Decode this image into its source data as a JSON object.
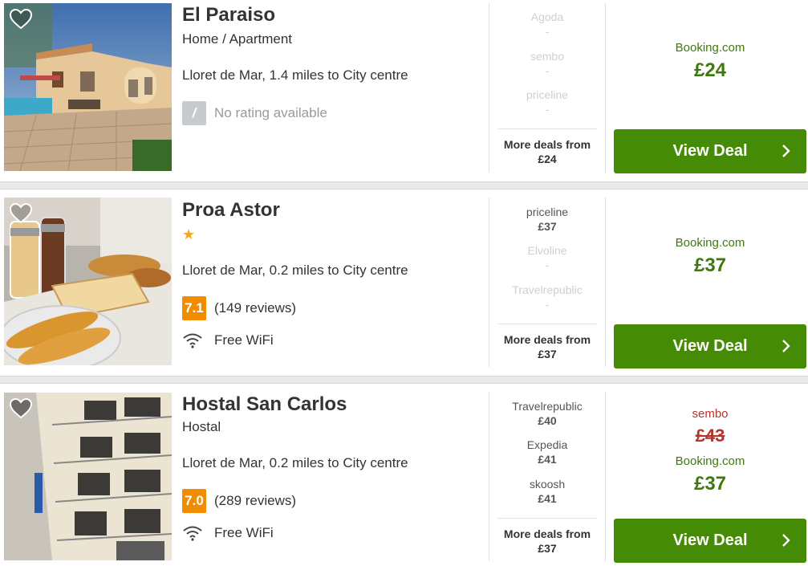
{
  "hotels": [
    {
      "name": "El Paraiso",
      "type": "Home / Apartment",
      "location": "Lloret de Mar, 1.4 miles to City centre",
      "score": "/",
      "rating_text": "No rating available",
      "deals": [
        {
          "provider": "Agoda",
          "price": "-"
        },
        {
          "provider": "sembo",
          "price": "-"
        },
        {
          "provider": "priceline",
          "price": "-"
        }
      ],
      "more_deals_label": "More deals from",
      "more_deals_price": "£24",
      "best_provider": "Booking.com",
      "best_price": "£24",
      "button": "View Deal"
    },
    {
      "name": "Proa Astor",
      "stars": "★",
      "location": "Lloret de Mar, 0.2 miles to City centre",
      "score": "7.1",
      "rating_text": "(149 reviews)",
      "amenity": "Free WiFi",
      "deals": [
        {
          "provider": "priceline",
          "price": "£37"
        },
        {
          "provider": "Elvoline",
          "price": "-"
        },
        {
          "provider": "Travelrepublic",
          "price": "-"
        }
      ],
      "more_deals_label": "More deals from",
      "more_deals_price": "£37",
      "best_provider": "Booking.com",
      "best_price": "£37",
      "button": "View Deal"
    },
    {
      "name": "Hostal San Carlos",
      "type": "Hostal",
      "location": "Lloret de Mar, 0.2 miles to City centre",
      "score": "7.0",
      "rating_text": "(289 reviews)",
      "amenity": "Free WiFi",
      "deals": [
        {
          "provider": "Travelrepublic",
          "price": "£40"
        },
        {
          "provider": "Expedia",
          "price": "£41"
        },
        {
          "provider": "skoosh",
          "price": "£41"
        }
      ],
      "more_deals_label": "More deals from",
      "more_deals_price": "£37",
      "old_provider": "sembo",
      "old_price": "£43",
      "best_provider": "Booking.com",
      "best_price": "£37",
      "button": "View Deal"
    }
  ],
  "colors": {
    "green": "#458b05",
    "price_green": "#3d7a0e",
    "orange_score": "#f18b00",
    "strike_red": "#b7342c"
  },
  "icons": [
    "heart-icon",
    "wifi-icon",
    "chevron-right-icon",
    "star-icon"
  ]
}
